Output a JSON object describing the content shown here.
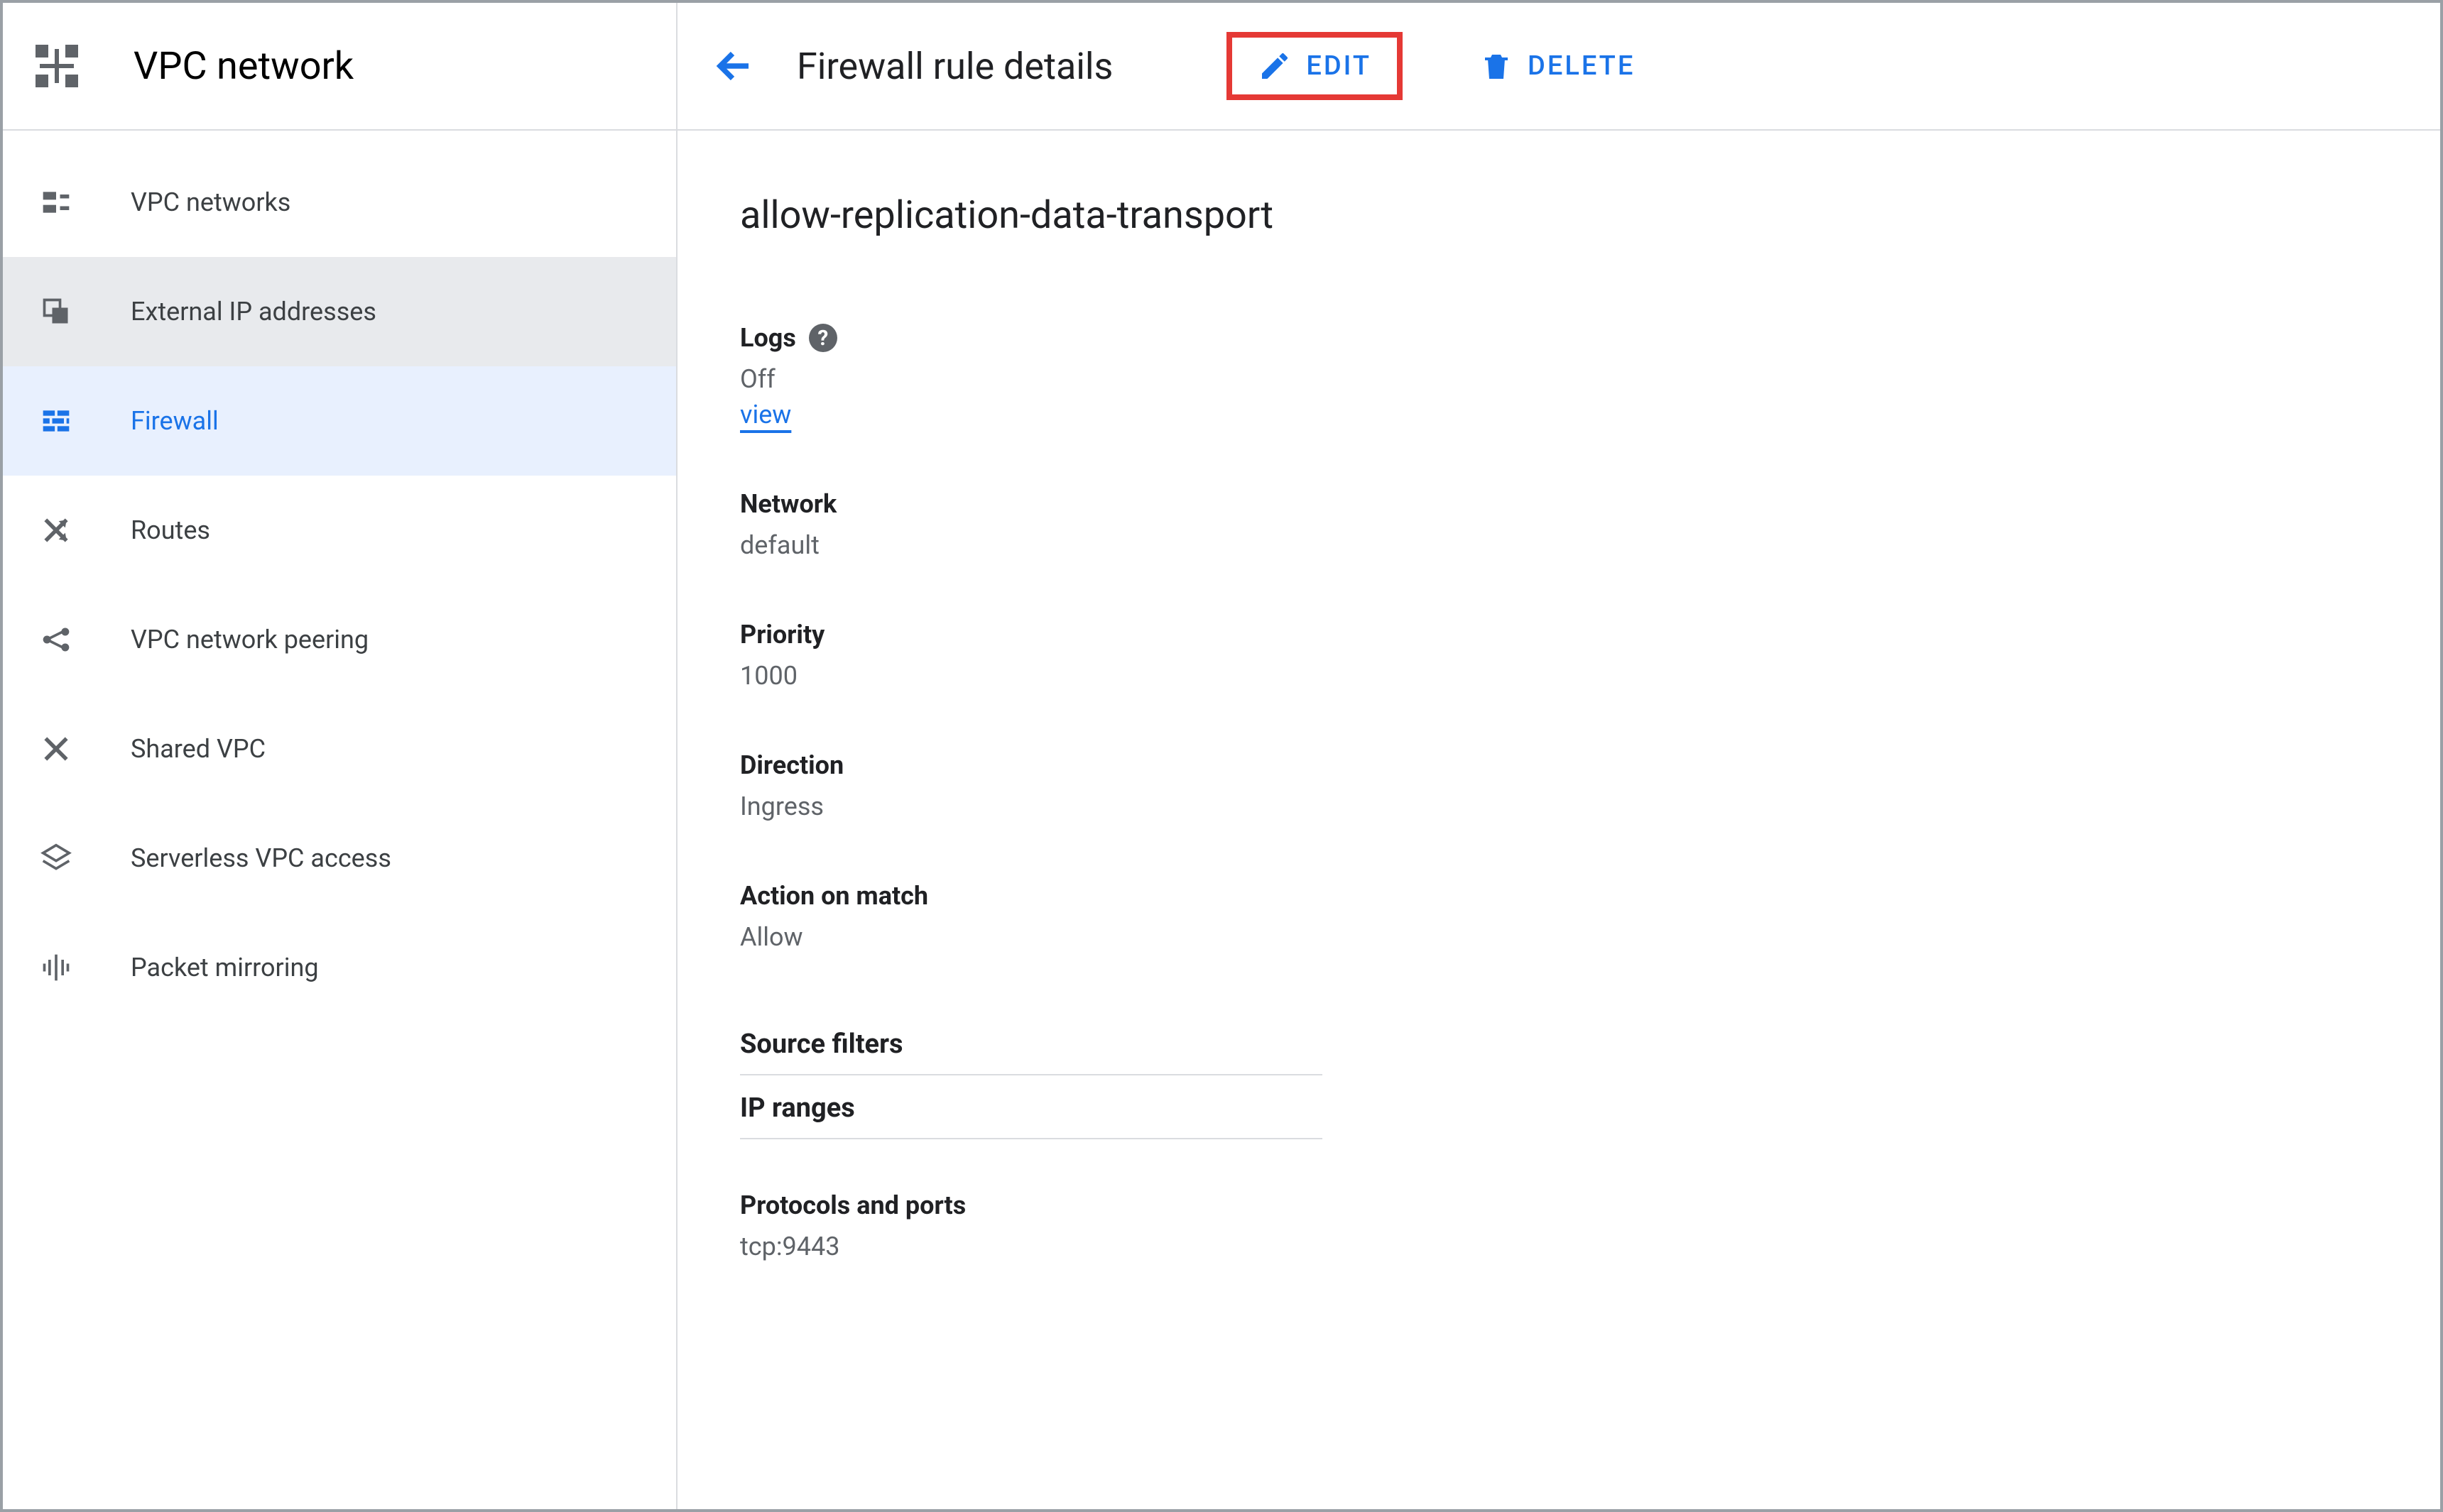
{
  "product": "VPC network",
  "nav": {
    "items": [
      {
        "label": "VPC networks"
      },
      {
        "label": "External IP addresses"
      },
      {
        "label": "Firewall"
      },
      {
        "label": "Routes"
      },
      {
        "label": "VPC network peering"
      },
      {
        "label": "Shared VPC"
      },
      {
        "label": "Serverless VPC access"
      },
      {
        "label": "Packet mirroring"
      }
    ]
  },
  "header": {
    "title": "Firewall rule details",
    "edit_label": "EDIT",
    "delete_label": "DELETE"
  },
  "rule": {
    "name": "allow-replication-data-transport",
    "logs_label": "Logs",
    "logs_value": "Off",
    "logs_view_link": "view",
    "network_label": "Network",
    "network_value": "default",
    "priority_label": "Priority",
    "priority_value": "1000",
    "direction_label": "Direction",
    "direction_value": "Ingress",
    "action_label": "Action on match",
    "action_value": "Allow",
    "source_filters_label": "Source filters",
    "ip_ranges_label": "IP ranges",
    "protocols_label": "Protocols and ports",
    "protocols_value": "tcp:9443"
  }
}
